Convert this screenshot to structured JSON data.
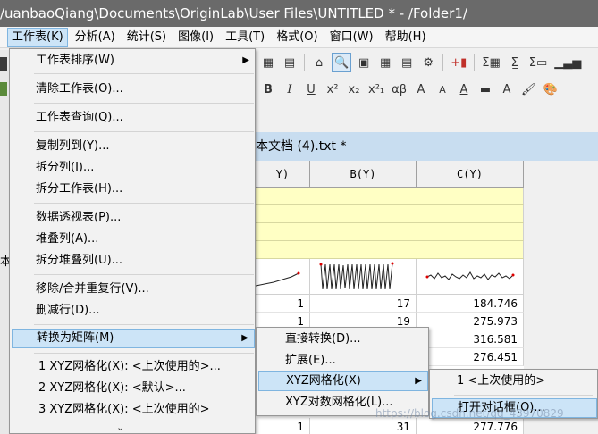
{
  "window": {
    "title": "/uanbaoQiang\\Documents\\OriginLab\\User Files\\UNTITLED * - /Folder1/"
  },
  "menubar": {
    "items": [
      {
        "label": "工作表(K)",
        "active": true
      },
      {
        "label": "分析(A)"
      },
      {
        "label": "统计(S)"
      },
      {
        "label": "图像(I)"
      },
      {
        "label": "工具(T)"
      },
      {
        "label": "格式(O)"
      },
      {
        "label": "窗口(W)"
      },
      {
        "label": "帮助(H)"
      }
    ]
  },
  "toolbar1": {
    "items": [
      "▦",
      "▤",
      "⌂",
      "🔍",
      "▣",
      "▦",
      "▤",
      "⚙",
      "+▮",
      "Σ▦",
      "Σ̲",
      "Σ▭",
      "▁▃▅"
    ]
  },
  "toolbar2": {
    "items": [
      "B",
      "I",
      "U",
      "x²",
      "x₂",
      "x²₁",
      "αβ",
      "A",
      "A",
      "A",
      "▬",
      "A",
      "🖌",
      "🎨"
    ]
  },
  "worksheet": {
    "title": "本文档 (4).txt *",
    "columns": [
      "Y)",
      "B(Y)",
      "C(Y)"
    ],
    "rows": [
      [
        "1",
        "17",
        "184.746"
      ],
      [
        "1",
        "19",
        "275.973"
      ],
      [
        "",
        "",
        "316.581"
      ],
      [
        "",
        "",
        "276.451"
      ],
      [
        "1",
        "31",
        "277.776"
      ]
    ]
  },
  "left_char": "本",
  "main_menu": {
    "items": [
      {
        "label": "工作表排序(W)",
        "submenu": true
      },
      {
        "label": "清除工作表(O)..."
      },
      {
        "label": "工作表查询(Q)..."
      },
      {
        "label": "复制列到(Y)..."
      },
      {
        "label": "拆分列(I)..."
      },
      {
        "label": "拆分工作表(H)..."
      },
      {
        "label": "数据透视表(P)..."
      },
      {
        "label": "堆叠列(A)..."
      },
      {
        "label": "拆分堆叠列(U)..."
      },
      {
        "label": "移除/合并重复行(V)..."
      },
      {
        "label": "删减行(D)..."
      },
      {
        "label": "转换为矩阵(M)",
        "submenu": true,
        "highlighted": true
      },
      {
        "label": "1 XYZ网格化(X): <上次使用的>..."
      },
      {
        "label": "2 XYZ网格化(X): <默认>..."
      },
      {
        "label": "3 XYZ网格化(X): <上次使用的>"
      }
    ],
    "more": "⌄"
  },
  "matrix_menu": {
    "items": [
      {
        "label": "直接转换(D)..."
      },
      {
        "label": "扩展(E)..."
      },
      {
        "label": "XYZ网格化(X)",
        "submenu": true,
        "highlighted": true
      },
      {
        "label": "XYZ对数网格化(L)..."
      }
    ]
  },
  "xyz_menu": {
    "items": [
      {
        "label": "1 <上次使用的>"
      },
      {
        "label": "打开对话框(O)...",
        "highlighted": true
      }
    ]
  },
  "watermark": "https://blog.csdn.net/qq_43970829"
}
